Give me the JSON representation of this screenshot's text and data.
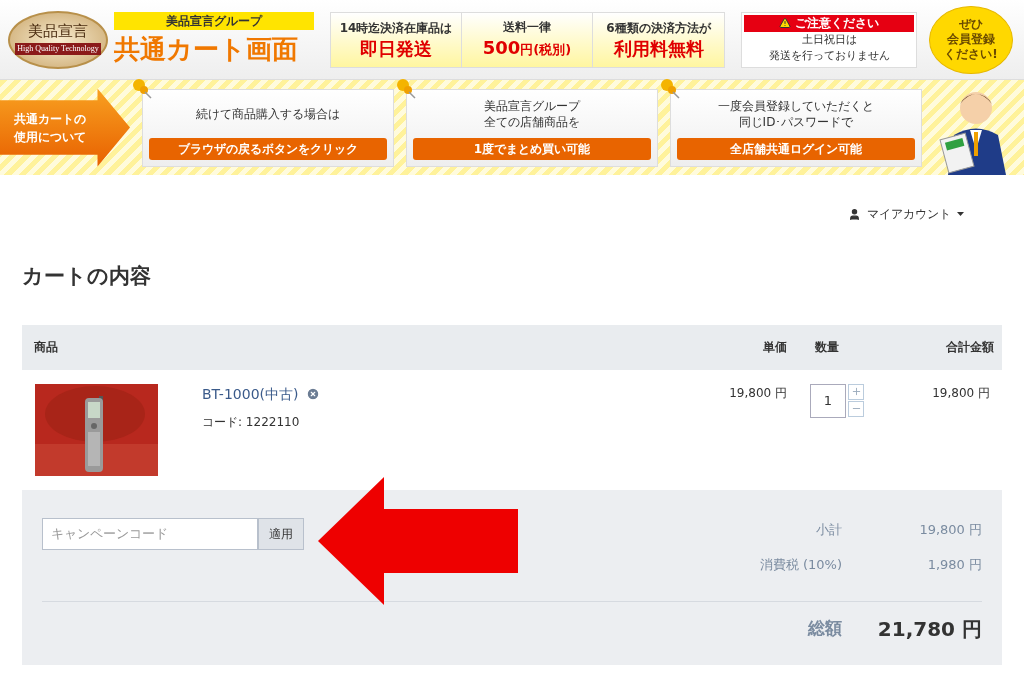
{
  "banner": {
    "logo": {
      "title": "美品宣言",
      "subtitle": "High Quality Technology"
    },
    "group_label": "美品宣言グループ",
    "heading": "共通カート画面",
    "features": [
      {
        "caption": "14時迄決済在庫品は",
        "highlight": "即日発送"
      },
      {
        "caption": "送料一律",
        "highlight": "500",
        "suffix": "円(税別)"
      },
      {
        "caption": "6種類の決済方法が",
        "highlight": "利用料無料"
      }
    ],
    "notice": {
      "title": "ご注意ください",
      "lines": [
        "土日祝日は",
        "発送を行っておりません"
      ]
    },
    "bubble": {
      "lines": [
        "ぜひ",
        "会員登録",
        "ください!"
      ]
    }
  },
  "info": {
    "label": [
      "共通カートの",
      "使用について"
    ],
    "cards": [
      {
        "lines": [
          "続けて商品購入する場合は"
        ],
        "button": "ブラウザの戻るボタンをクリック"
      },
      {
        "lines": [
          "美品宣言グループ",
          "全ての店舗商品を"
        ],
        "button": "1度でまとめ買い可能"
      },
      {
        "lines": [
          "一度会員登録していただくと",
          "同じID･パスワードで"
        ],
        "button": "全店舗共通ログイン可能"
      }
    ]
  },
  "account_menu": "マイアカウント",
  "cart_title": "カートの内容",
  "table": {
    "columns": [
      "商品",
      "単価",
      "数量",
      "合計金額"
    ],
    "rows": [
      {
        "kind": "picture",
        "name": "BT-1000(中古)",
        "code": "コード: 1222110",
        "unit_price": "19,800 円",
        "quantity": "1",
        "total": "19,800 円"
      }
    ]
  },
  "coupon": {
    "placeholder": "キャンペーンコード",
    "button": "適用"
  },
  "summary": [
    {
      "label": "小計",
      "value": "19,800 円"
    },
    {
      "label": "消費税 (10%)",
      "value": "1,980 円"
    }
  ],
  "total": {
    "label": "総額",
    "value": "21,780 円"
  }
}
